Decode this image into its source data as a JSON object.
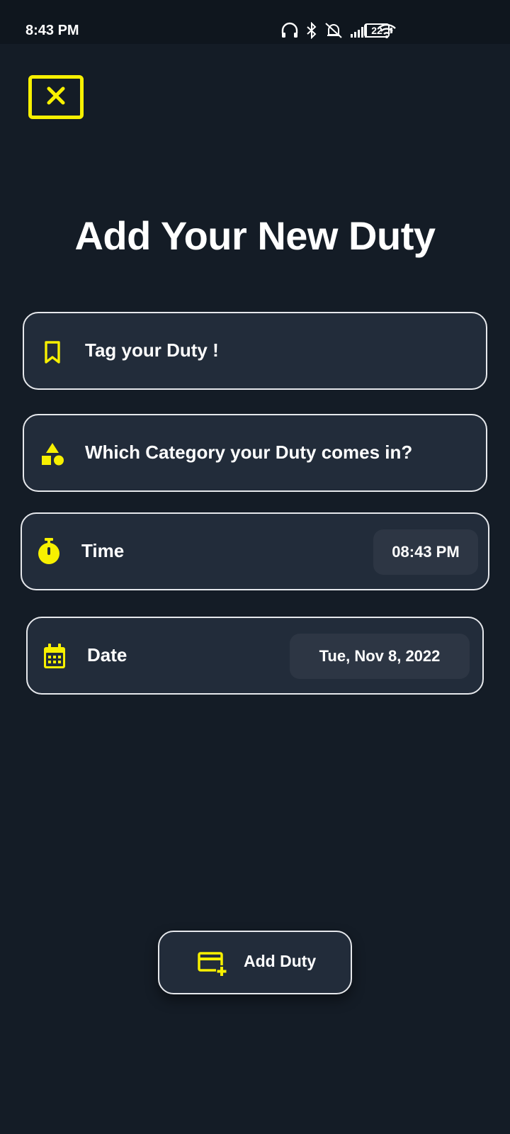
{
  "status_bar": {
    "time": "8:43 PM",
    "battery": "22",
    "icons": [
      "headset-icon",
      "bluetooth-icon",
      "alarm-off-icon",
      "signal-icon",
      "wifi-icon",
      "battery-icon"
    ]
  },
  "header": {
    "title": "Add Your New Duty"
  },
  "form": {
    "tag": {
      "placeholder": "Tag your Duty !",
      "icon": "bookmark-icon"
    },
    "category": {
      "placeholder": "Which Category your Duty comes in?",
      "icon": "category-shapes-icon"
    },
    "time": {
      "label": "Time",
      "value": "08:43 PM",
      "icon": "stopwatch-icon"
    },
    "date": {
      "label": "Date",
      "value": "Tue, Nov 8, 2022",
      "icon": "calendar-icon"
    }
  },
  "actions": {
    "add_label": "Add Duty",
    "icon": "add-card-icon"
  },
  "colors": {
    "background": "#141c26",
    "field_background": "#222c3a",
    "accent": "#f7f000",
    "border": "#e6e8ec",
    "text": "#ffffff"
  }
}
